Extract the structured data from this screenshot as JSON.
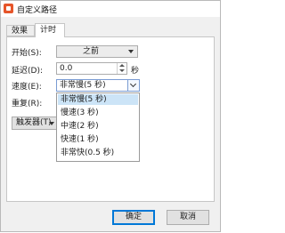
{
  "window": {
    "title": "自定义路径",
    "accent": "#e6552a"
  },
  "tabs": [
    {
      "label": "效果"
    },
    {
      "label": "计时"
    }
  ],
  "timing": {
    "start_label": "开始(S):",
    "start_value": "之前",
    "delay_label": "延迟(D):",
    "delay_value": "0.0",
    "delay_unit": "秒",
    "speed_label": "速度(E):",
    "speed_value": "非常慢(5 秒)",
    "repeat_label": "重复(R):",
    "trigger_label": "触发器(T)"
  },
  "speed_options": [
    {
      "label": "非常慢(5 秒)",
      "selected": true
    },
    {
      "label": "慢速(3 秒)"
    },
    {
      "label": "中速(2 秒)"
    },
    {
      "label": "快速(1 秒)"
    },
    {
      "label": "非常快(0.5 秒)"
    }
  ],
  "buttons": {
    "ok": "确定",
    "cancel": "取消"
  }
}
